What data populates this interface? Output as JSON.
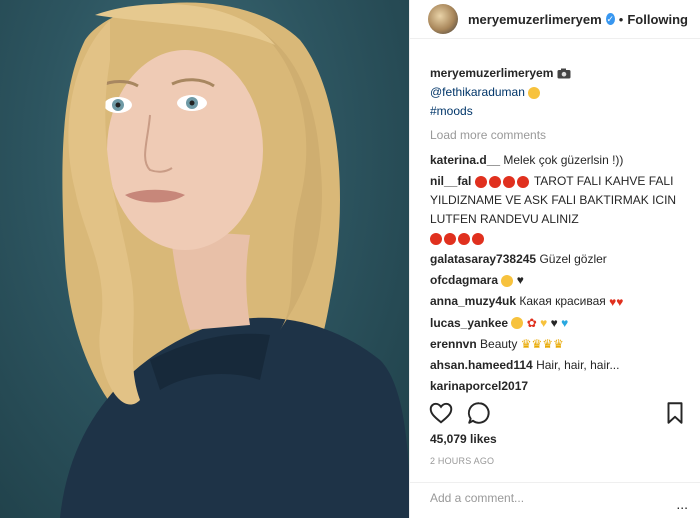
{
  "header": {
    "username": "meryemuzerlimeryem",
    "follow_label": "Following",
    "dot": "•"
  },
  "caption": {
    "username": "meryemuzerlimeryem",
    "mention": "@fethikaraduman",
    "hashtag": "#moods"
  },
  "load_more": "Load more comments",
  "comments": [
    {
      "user": "katerina.d__",
      "text": "Melek çok güzerlsin !))"
    },
    {
      "user": "nil__fal",
      "text": "TAROT FALI KAHVE FALI YILDIZNAME VE ASK FALI BAKTIRMAK ICIN LUTFEN RANDEVU ALINIZ"
    },
    {
      "user": "galatasaray738245",
      "text": "Güzel gözler"
    },
    {
      "user": "ofcdagmara",
      "text": ""
    },
    {
      "user": "anna_muzy4uk",
      "text": "Какая красивая"
    },
    {
      "user": "lucas_yankee",
      "text": ""
    },
    {
      "user": "erennvn",
      "text": "Beauty"
    },
    {
      "user": "ahsan.hameed114",
      "text": "Hair, hair, hair..."
    },
    {
      "user": "karinaporcel2017",
      "text": ""
    }
  ],
  "likes": "45,079 likes",
  "time": "2 HOURS AGO",
  "add_comment_placeholder": "Add a comment...",
  "more_dots": "...",
  "icons": [
    "heart-icon",
    "comment-icon",
    "bookmark-icon",
    "camera-icon",
    "verified-icon"
  ],
  "colors": {
    "accent": "#3897f0",
    "link": "#003569",
    "photo_bg": "#2d5560"
  }
}
